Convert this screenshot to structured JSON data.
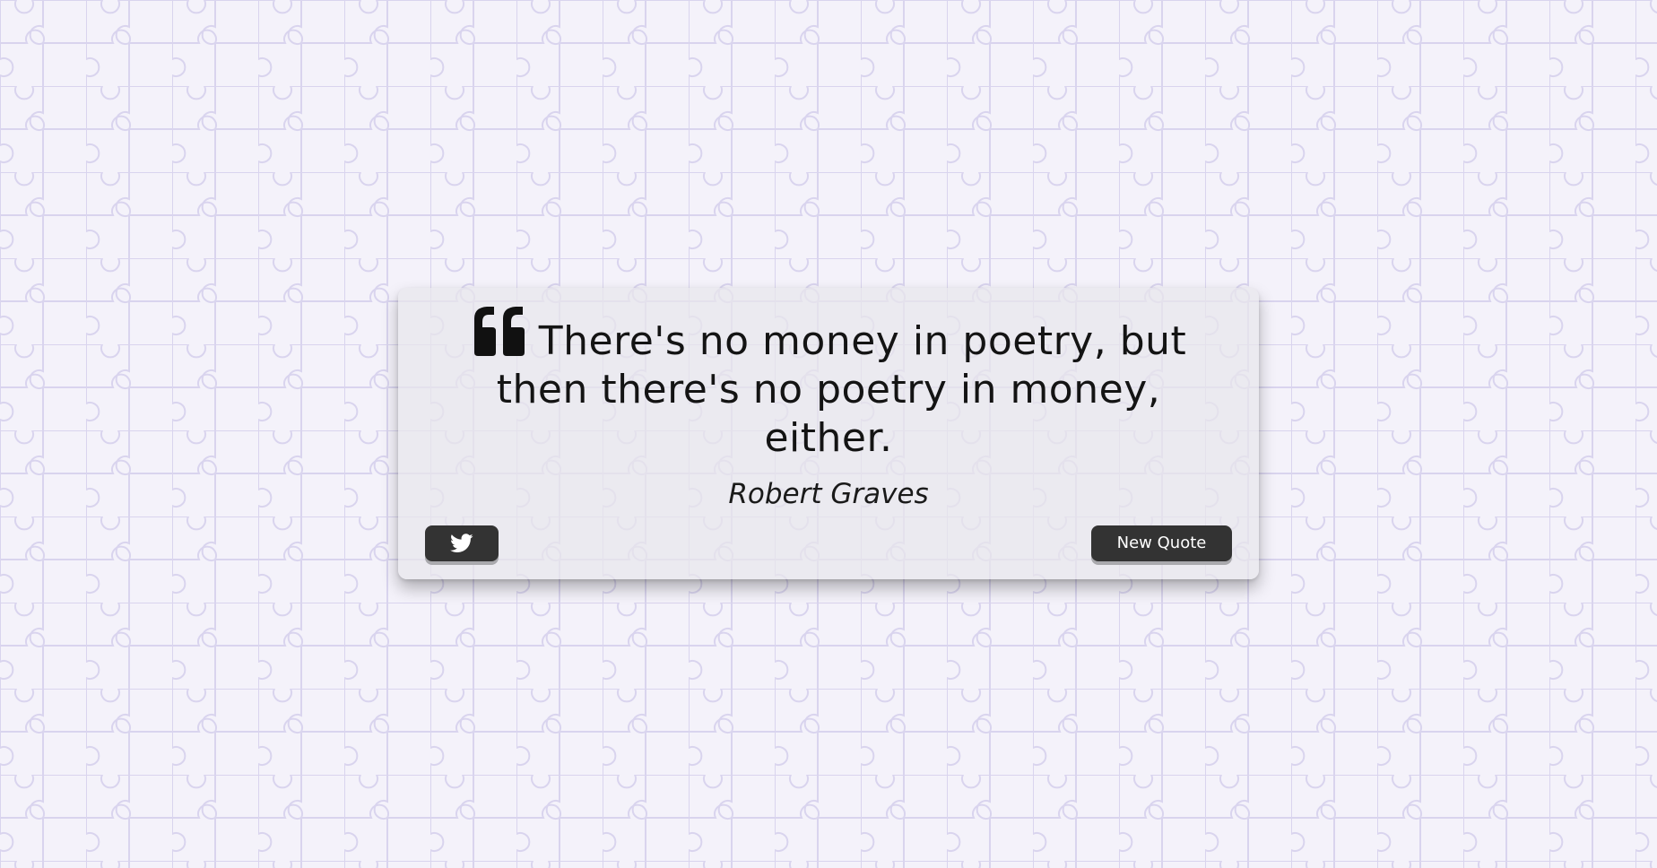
{
  "quote": {
    "text": "There's no money in poetry, but then there's no poetry in money, either.",
    "author": "Robert Graves"
  },
  "icons": {
    "quote_mark": "quote-left-icon",
    "tweet": "twitter-icon"
  },
  "buttons": {
    "new_quote_label": "New Quote"
  },
  "colors": {
    "background": "#f4f2fa",
    "pattern_line": "#d9d4ee",
    "card": "#e8e6ec",
    "button": "#333333",
    "button_text": "#ffffff"
  }
}
